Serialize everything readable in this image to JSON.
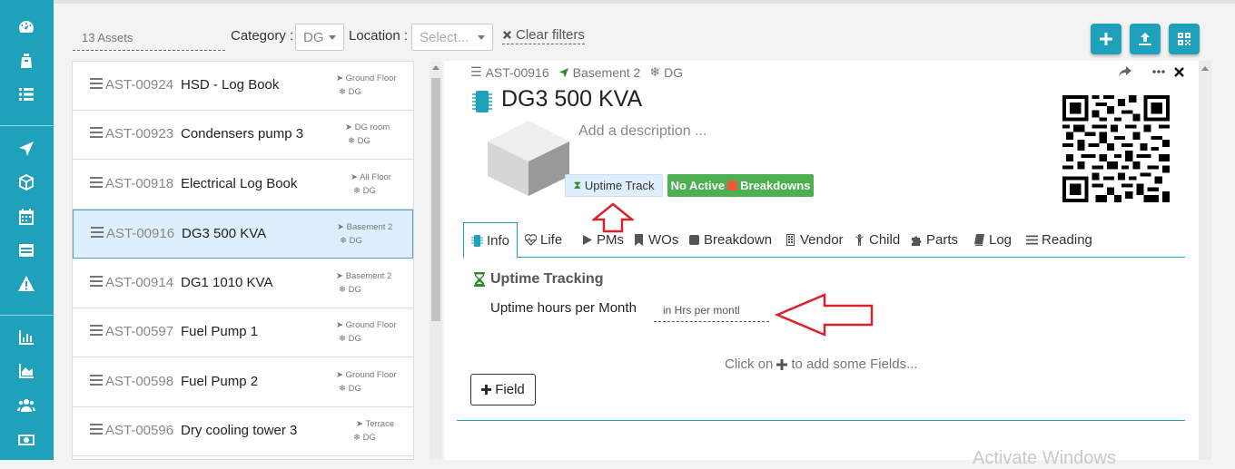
{
  "colors": {
    "brand": "#1fa1bc",
    "green": "#4caf50",
    "arrow": "#d9232b",
    "selected_row": "#ddeefd"
  },
  "sidebar": {
    "icons": [
      "dashboard-icon",
      "assets-icon",
      "list-icon",
      "location-arrow-icon",
      "cube-icon",
      "calendar-icon",
      "table-icon",
      "warning-icon",
      "bar-chart-icon",
      "area-chart-icon",
      "users-icon",
      "money-icon"
    ]
  },
  "filters": {
    "assets_count": "13 Assets",
    "category_label": "Category :",
    "category_value": "DG",
    "location_label": "Location :",
    "location_placeholder": "Select...",
    "clear_label": "Clear filters"
  },
  "toolbar": {
    "buttons": [
      "add-icon",
      "upload-icon",
      "qrcode-icon"
    ]
  },
  "assets": [
    {
      "code": "AST-00924",
      "name": "HSD - Log Book",
      "location": "Ground Floor",
      "category": "DG"
    },
    {
      "code": "AST-00923",
      "name": "Condensers pump 3",
      "location": "DG room",
      "category": "DG"
    },
    {
      "code": "AST-00918",
      "name": "Electrical Log Book",
      "location": "All Floor",
      "category": "DG"
    },
    {
      "code": "AST-00916",
      "name": "DG3 500 KVA",
      "location": "Basement 2",
      "category": "DG",
      "selected": true
    },
    {
      "code": "AST-00914",
      "name": "DG1 1010 KVA",
      "location": "Basement 2",
      "category": "DG"
    },
    {
      "code": "AST-00597",
      "name": "Fuel Pump 1",
      "location": "Ground Floor",
      "category": "DG"
    },
    {
      "code": "AST-00598",
      "name": "Fuel Pump 2",
      "location": "Ground Floor",
      "category": "DG"
    },
    {
      "code": "AST-00596",
      "name": "Dry cooling tower 3",
      "location": "Terrace",
      "category": "DG"
    }
  ],
  "detail": {
    "code": "AST-00916",
    "location": "Basement 2",
    "category": "DG",
    "title": "DG3 500 KVA",
    "description_placeholder": "Add a description ...",
    "uptime_badge": "Uptime Track",
    "breakdown_prefix": "No Active",
    "breakdown_word": "Breakdowns",
    "tabs": [
      {
        "label": "Info",
        "icon": "info-icon",
        "active": true
      },
      {
        "label": "Life",
        "icon": "heartbeat-icon"
      },
      {
        "label": "PMs",
        "icon": "play-icon"
      },
      {
        "label": "WOs",
        "icon": "bookmark-icon"
      },
      {
        "label": "Breakdown",
        "icon": "stop-icon"
      },
      {
        "label": "Vendor",
        "icon": "building-icon"
      },
      {
        "label": "Child",
        "icon": "child-icon"
      },
      {
        "label": "Parts",
        "icon": "puzzle-icon"
      },
      {
        "label": "Log",
        "icon": "book-icon"
      },
      {
        "label": "Reading",
        "icon": "reading-list-icon"
      }
    ],
    "section_title": "Uptime Tracking",
    "field_label": "Uptime hours per Month",
    "field_placeholder": "in Hrs per montl",
    "hint_prefix": "Click on",
    "hint_suffix": "to add some Fields...",
    "add_field_label": "Field"
  },
  "watermark": "Activate Windows"
}
